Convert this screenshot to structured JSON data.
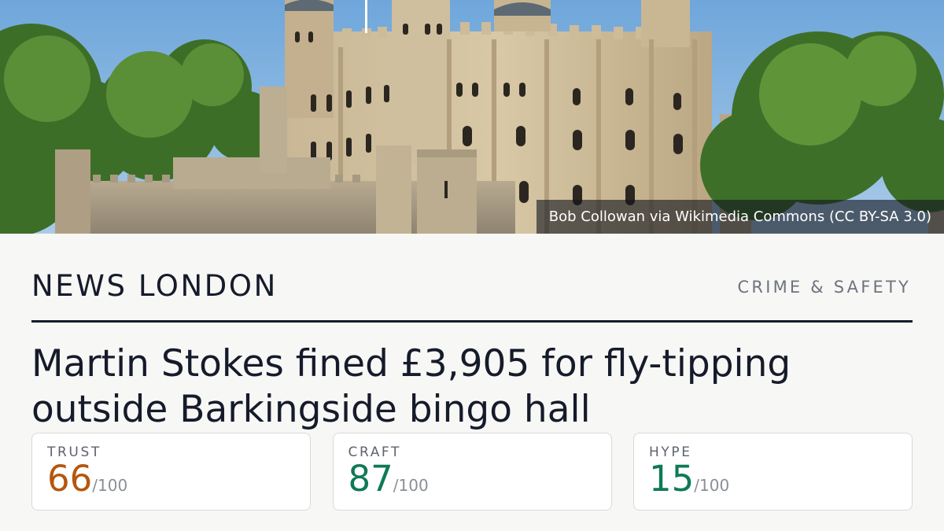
{
  "hero": {
    "photo_credit": "Bob Collowan via Wikimedia Commons (CC BY-SA 3.0)"
  },
  "header": {
    "brand": "NEWS LONDON",
    "section": "CRIME & SAFETY"
  },
  "article": {
    "headline": "Martin Stokes fined £3,905 for fly-tipping outside Barkingside bingo hall"
  },
  "ratings": [
    {
      "label": "TRUST",
      "score": "66",
      "max": "/100",
      "color": "#b5560f"
    },
    {
      "label": "CRAFT",
      "score": "87",
      "max": "/100",
      "color": "#0f7a55"
    },
    {
      "label": "HYPE",
      "score": "15",
      "max": "/100",
      "color": "#0f7a55"
    }
  ]
}
